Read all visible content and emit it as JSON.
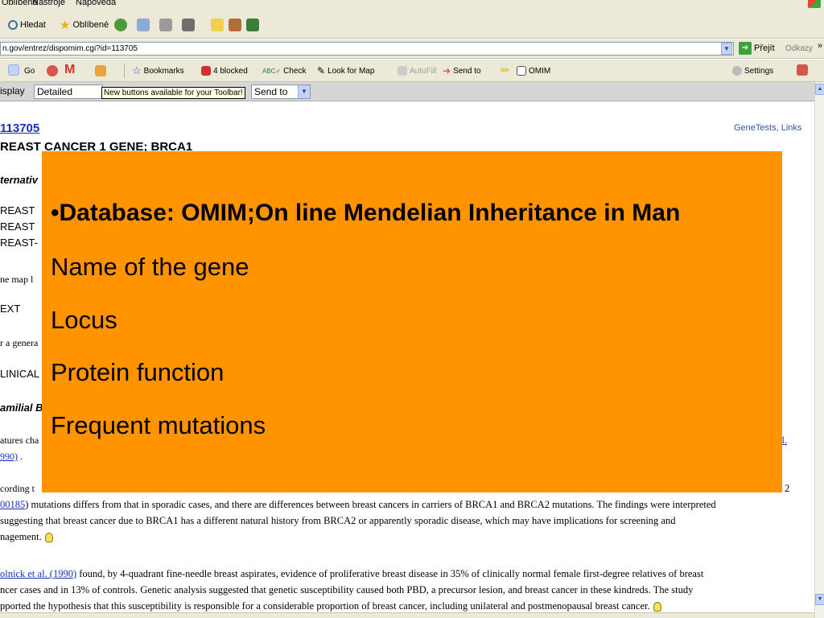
{
  "menubar": {
    "items": [
      "Oblíbené",
      "Nástroje",
      "Nápověda"
    ]
  },
  "toolbar": {
    "search": "Hledat",
    "favorites": "Oblíbené"
  },
  "address": {
    "url": "n.gov/entrez/dispomim.cgi?id=113705",
    "go": "Přejít",
    "links": "Odkazy",
    "more": "»"
  },
  "googlebar": {
    "go": "Go",
    "bookmarks": "Bookmarks",
    "blocked": "4 blocked",
    "check": "Check",
    "lookup": "Look for Map",
    "autofill": "AutoFill",
    "sendto": "Send to",
    "omim": "OMIM",
    "settings": "Settings"
  },
  "ncbi": {
    "display_label": "isplay",
    "display_value": "Detailed",
    "tooltip": "New buttons available for your Toolbar!",
    "sendto_value": "Send to"
  },
  "record": {
    "id": "113705",
    "title": "REAST CANCER 1 GENE; BRCA1",
    "genetests": "GeneTests, Links",
    "fragments": {
      "alt": "ternativ",
      "b1": "REAST",
      "b2": "REAST",
      "b3": "REAST-",
      "genemap": "ne map l",
      "text": "EXT",
      "general": "r a genera",
      "clinical": "LINICAL",
      "familial": "amilial B",
      "features": "atures cha",
      "year": "990)",
      "ref_right": "al.",
      "according": "cording t",
      "num_right": "2",
      "period": "."
    },
    "paragraph1": [
      {
        "link": "00185",
        "text": ") mutations differs from that in sporadic cases, and there are differences between breast cancers in carriers of BRCA1 and BRCA2 mutations. The findings were interpreted"
      },
      {
        "link": "",
        "text": " suggesting that breast cancer due to BRCA1 has a different natural history from BRCA2 or apparently sporadic disease, which may have implications for screening and"
      },
      {
        "link": "",
        "text": "nagement."
      }
    ],
    "paragraph2": [
      {
        "link": "olnick et al. (1990)",
        "text": " found, by 4-quadrant fine-needle breast aspirates, evidence of proliferative breast disease in 35% of clinically normal female first-degree relatives of breast"
      },
      {
        "link": "",
        "text": "ncer cases and in 13% of controls. Genetic analysis suggested that genetic susceptibility caused both PBD, a precursor lesion, and breast cancer in these kindreds. The study"
      },
      {
        "link": "",
        "text": "pported the hypothesis that this susceptibility is responsible for a considerable proportion of breast cancer, including unilateral and postmenopausal breast cancer."
      }
    ]
  },
  "slide": {
    "bullet": "•",
    "heading": "Database: OMIM;On line Mendelian Inheritance in Man",
    "items": [
      "Name of the gene",
      "Locus",
      "Protein function",
      "Frequent mutations"
    ],
    "bg_color": "#ff9300"
  },
  "icons": [
    "search-icon",
    "star-icon",
    "arrow-right-icon",
    "dropdown-arrow-icon",
    "lightbulb-icon"
  ]
}
